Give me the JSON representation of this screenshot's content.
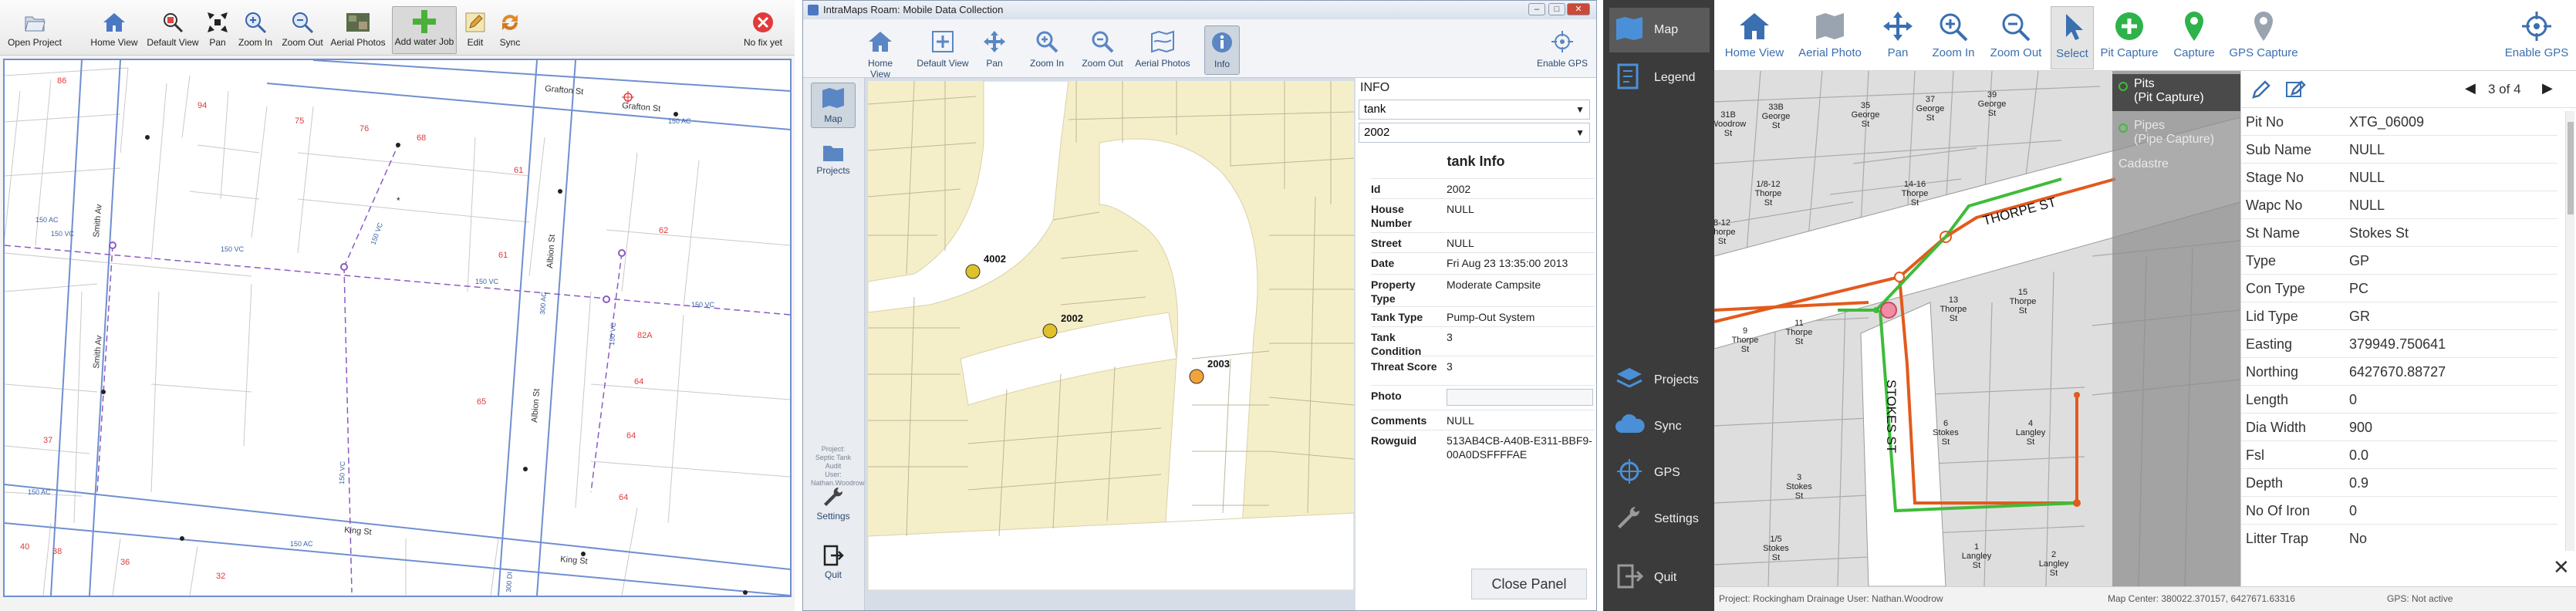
{
  "left_app": {
    "toolbar": {
      "open_project": "Open Project",
      "home_view": "Home View",
      "default_view": "Default View",
      "pan": "Pan",
      "zoom_in": "Zoom In",
      "zoom_out": "Zoom Out",
      "aerial_photos": "Aerial Photos",
      "add_water_job": "Add water Job",
      "edit": "Edit",
      "sync": "Sync",
      "gps_status": "No fix yet"
    },
    "map": {
      "streets": [
        "Grafton St",
        "Grafton St",
        "Smith Av",
        "Smith Av",
        "Albion St",
        "Albion St",
        "King St",
        "King St"
      ],
      "lot_numbers": [
        "86",
        "94",
        "75",
        "76",
        "68",
        "61",
        "62",
        "61",
        "82A",
        "64",
        "64",
        "64",
        "65",
        "37",
        "36",
        "32",
        "40",
        "38"
      ],
      "pipe_labels": [
        "150 AC",
        "150 AC",
        "150 VC",
        "150 VC",
        "150 VC",
        "150 VC",
        "150 VC",
        "150 VC",
        "300 AC",
        "150 AC",
        "150 AC",
        "150 VC",
        "300 DI"
      ]
    }
  },
  "mid_app": {
    "window_title": "IntraMaps Roam: Mobile Data Collection",
    "toolbar": {
      "home_view": "Home View",
      "default_view": "Default View",
      "pan": "Pan",
      "zoom_in": "Zoom In",
      "zoom_out": "Zoom Out",
      "aerial_photos": "Aerial Photos",
      "info": "Info",
      "enable_gps": "Enable GPS"
    },
    "side": {
      "map": "Map",
      "projects": "Projects",
      "project_info": [
        "Project:",
        "Septic Tank Audit",
        "User:",
        "Nathan.Woodrow"
      ],
      "settings": "Settings",
      "quit": "Quit"
    },
    "map": {
      "markers": [
        "4002",
        "2002",
        "2003"
      ]
    },
    "info": {
      "header": "INFO",
      "layer_select": "tank",
      "feature_select": "2002",
      "title": "tank Info",
      "fields": [
        {
          "k": "Id",
          "v": "2002"
        },
        {
          "k": "House Number",
          "v": "NULL"
        },
        {
          "k": "Street",
          "v": "NULL"
        },
        {
          "k": "Date",
          "v": "Fri Aug 23 13:35:00 2013"
        },
        {
          "k": "Property Type",
          "v": "Moderate Campsite"
        },
        {
          "k": "Tank Type",
          "v": "Pump-Out System"
        },
        {
          "k": "Tank Condition",
          "v": "3"
        },
        {
          "k": "Threat Score",
          "v": "3"
        },
        {
          "k": "Photo",
          "v": ""
        },
        {
          "k": "Comments",
          "v": "NULL"
        },
        {
          "k": "Rowguid",
          "v": "513AB4CB-A40B-E311-BBF9-00A0DSFFFFAE"
        }
      ],
      "close_panel": "Close Panel"
    }
  },
  "right_app": {
    "side": {
      "map": "Map",
      "legend": "Legend",
      "projects": "Projects",
      "sync": "Sync",
      "gps": "GPS",
      "settings": "Settings",
      "quit": "Quit"
    },
    "toolbar": {
      "home_view": "Home View",
      "aerial_photo": "Aerial Photo",
      "pan": "Pan",
      "zoom_in": "Zoom In",
      "zoom_out": "Zoom Out",
      "select": "Select",
      "pit_capture": "Pit Capture",
      "capture": "Capture",
      "gps_capture": "GPS Capture",
      "enable_gps": "Enable GPS"
    },
    "layers": {
      "pits_title": "Pits",
      "pits_sub": "(Pit Capture)",
      "pipes_title": "Pipes",
      "pipes_sub": "(Pipe Capture)",
      "cadastre": "Cadastre"
    },
    "map": {
      "streets": [
        "THORPE ST",
        "STOKES ST"
      ],
      "lots": [
        [
          "31B",
          "Woodrow",
          "St"
        ],
        [
          "33B",
          "George",
          "St"
        ],
        [
          "35",
          "George",
          "St"
        ],
        [
          "37",
          "George",
          "St"
        ],
        [
          "39",
          "George",
          "St"
        ],
        [
          "14-16",
          "Thorpe",
          "St"
        ],
        [
          "1/8-12",
          "Thorpe",
          "St"
        ],
        [
          "8-12",
          "Thorpe",
          "St"
        ],
        [
          "13",
          "Thorpe",
          "St"
        ],
        [
          "15",
          "Thorpe",
          "St"
        ],
        [
          "9",
          "Thorpe",
          "St"
        ],
        [
          "11",
          "Thorpe",
          "St"
        ],
        [
          "3",
          "Stokes",
          "St"
        ],
        [
          "1/5",
          "Stokes",
          "St"
        ],
        [
          "6",
          "Stokes",
          "St"
        ],
        [
          "4",
          "Langley",
          "St"
        ],
        [
          "1",
          "Langley",
          "St"
        ],
        [
          "2",
          "Langley",
          "St"
        ]
      ]
    },
    "attributes": {
      "pager": "3 of 4",
      "fields": [
        {
          "k": "Pit No",
          "v": "XTG_06009"
        },
        {
          "k": "Sub Name",
          "v": "NULL"
        },
        {
          "k": "Stage No",
          "v": "NULL"
        },
        {
          "k": "Wapc No",
          "v": "NULL"
        },
        {
          "k": "St Name",
          "v": "Stokes St"
        },
        {
          "k": "Type",
          "v": "GP"
        },
        {
          "k": "Con Type",
          "v": "PC"
        },
        {
          "k": "Lid Type",
          "v": "GR"
        },
        {
          "k": "Easting",
          "v": "379949.750641"
        },
        {
          "k": "Northing",
          "v": "6427670.88727"
        },
        {
          "k": "Length",
          "v": "0"
        },
        {
          "k": "Dia Width",
          "v": "900"
        },
        {
          "k": "Fsl",
          "v": "0.0"
        },
        {
          "k": "Depth",
          "v": "0.9"
        },
        {
          "k": "No Of Iron",
          "v": "0"
        },
        {
          "k": "Litter Trap",
          "v": "No"
        }
      ]
    },
    "status": {
      "project": "Project: Rockingham Drainage  User: Nathan.Woodrow",
      "map_center": "Map Center: 380022.370157, 6427671.63316",
      "gps": "GPS: Not active"
    }
  }
}
